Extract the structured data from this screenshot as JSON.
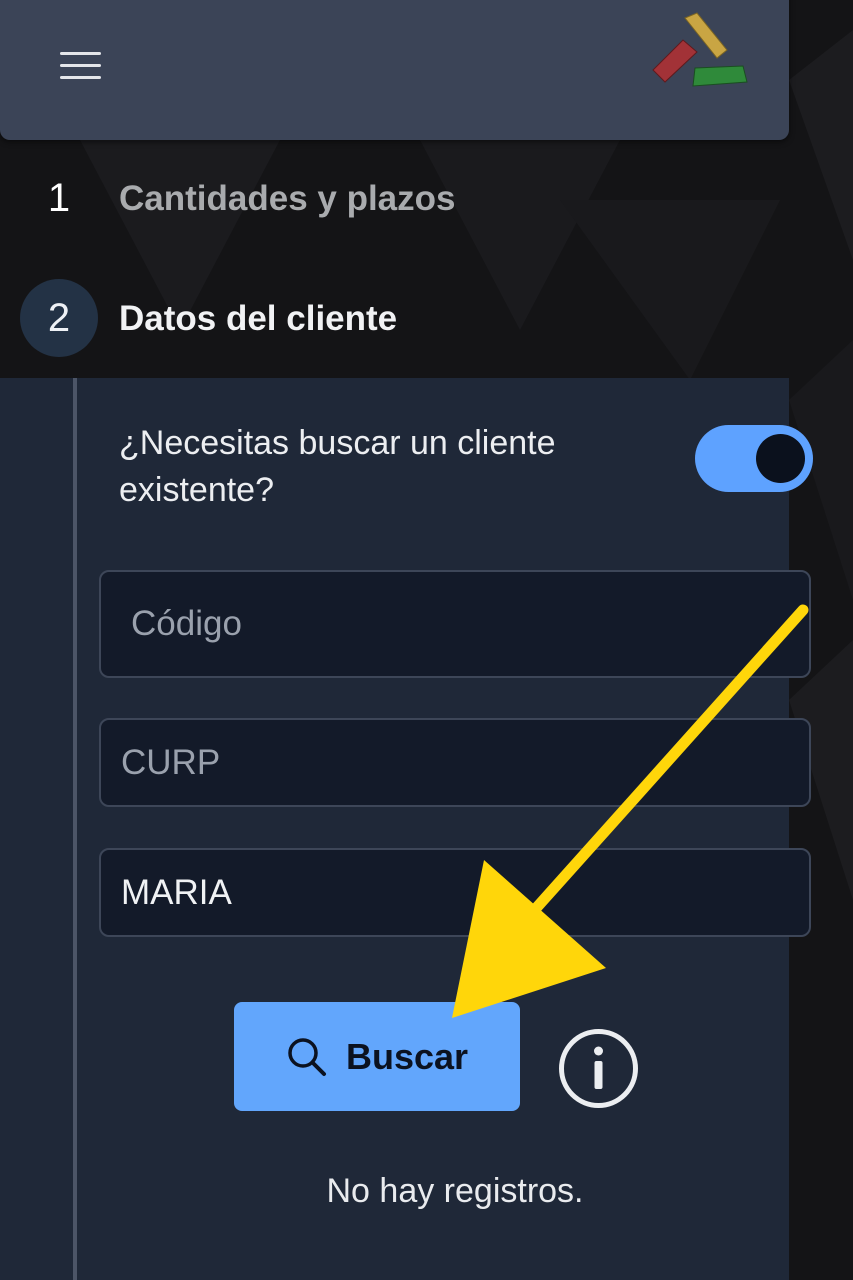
{
  "header": {
    "menu_icon": "hamburger-menu-icon",
    "logo_icon": "app-logo"
  },
  "steps": [
    {
      "number": "1",
      "label": "Cantidades y plazos"
    },
    {
      "number": "2",
      "label": "Datos del cliente"
    }
  ],
  "form": {
    "question": "¿Necesitas buscar un cliente existente?",
    "toggle_on": true,
    "codigo": {
      "placeholder": "Código",
      "value": ""
    },
    "curp": {
      "placeholder": "CURP",
      "value": ""
    },
    "nombre": {
      "placeholder": "",
      "value": "MARIA"
    },
    "buscar_label": "Buscar",
    "info_icon": "info-icon",
    "empty_message": "No hay registros."
  },
  "annotation": {
    "arrow_color": "#ffd60a"
  },
  "colors": {
    "header_bg": "#3b4457",
    "panel_bg": "#1f2838",
    "accent": "#62a6fc",
    "input_bg": "#131a29"
  }
}
